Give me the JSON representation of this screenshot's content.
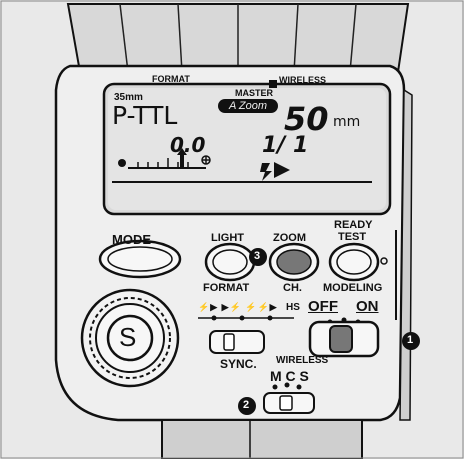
{
  "lcd": {
    "format": "FORMAT",
    "wireless": "WIRELESS",
    "format_size": "35mm",
    "master": "MASTER",
    "mode": "P-TTL",
    "zoom_badge": "A Zoom",
    "zoom_value": "50",
    "zoom_unit": "mm",
    "exposure_comp": "0.0",
    "power_ratio": "1/ 1"
  },
  "buttons": {
    "mode": "MODE",
    "light": "LIGHT",
    "format": "FORMAT",
    "zoom": "ZOOM",
    "ch": "CH.",
    "ready_test_1": "READY",
    "ready_test_2": "TEST",
    "modeling": "MODELING",
    "select": "S"
  },
  "switches": {
    "hs": "HS",
    "off": "OFF",
    "on": "ON",
    "sync": "SYNC.",
    "wireless": "WIRELESS",
    "mcs": "M C S"
  },
  "callouts": [
    "1",
    "2",
    "3"
  ]
}
